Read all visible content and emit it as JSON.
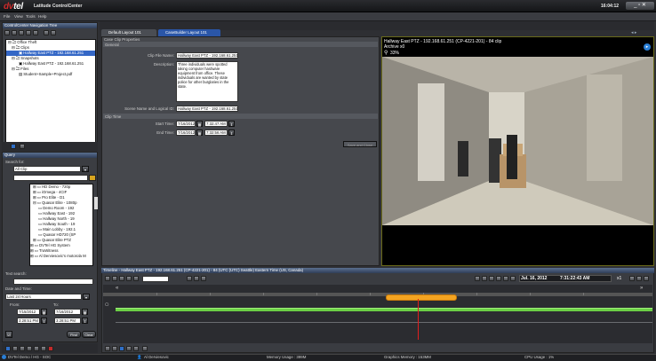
{
  "app": {
    "logo_prefix": "dv",
    "logo_suffix": "tel",
    "title": "Latitude ControlCenter",
    "clock": "16:04:12"
  },
  "menu": [
    "File",
    "View",
    "Tools",
    "Help"
  ],
  "nav_tree": {
    "title": "ControlCenter Navigation Tree",
    "items": [
      {
        "label": "Office Theft",
        "depth": 0
      },
      {
        "label": "Clips",
        "depth": 1
      },
      {
        "label": "Hallway East PTZ - 192.168.61.251",
        "depth": 2,
        "selected": true
      },
      {
        "label": "Snapshots",
        "depth": 1
      },
      {
        "label": "Hallway East PTZ - 192.168.61.251",
        "depth": 2
      },
      {
        "label": "Files",
        "depth": 1
      },
      {
        "label": "Student+Sample+Project.pdf",
        "depth": 2
      }
    ]
  },
  "query": {
    "title": "Query",
    "search_for_label": "Search for:",
    "search_for_value": "All Clip",
    "tree_items": [
      {
        "label": "HD Demo - 720p",
        "depth": 1
      },
      {
        "label": "iOmega - 4CIF",
        "depth": 1
      },
      {
        "label": "Pro Elite - D1",
        "depth": 1
      },
      {
        "label": "Quasar Elite - 1080p",
        "depth": 1
      },
      {
        "label": "Demo Room - 192",
        "depth": 2
      },
      {
        "label": "Hallway East - 192",
        "depth": 2
      },
      {
        "label": "Hallway North - 19",
        "depth": 2
      },
      {
        "label": "Hallway South - 19",
        "depth": 2
      },
      {
        "label": "Main Lobby - 192.1",
        "depth": 2
      },
      {
        "label": "Quasar HD720 (SP",
        "depth": 2
      },
      {
        "label": "Quasar Elite PTZ",
        "depth": 1
      },
      {
        "label": "DVTel HG System",
        "depth": 0
      },
      {
        "label": "TruWitness",
        "depth": 0
      },
      {
        "label": "Al Derviesovic's motorola M",
        "depth": 0
      }
    ],
    "text_search_label": "Text search:",
    "date_time_label": "Date and Time:",
    "date_range_value": "Last 24 Hours",
    "from_label": "From:",
    "to_label": "To:",
    "from_date": "7/15/2012",
    "to_date": "7/16/2012",
    "from_time": "3:28:51 PM",
    "to_time": "3:28:51 PM",
    "find_button": "Find",
    "clear_button": "Clear"
  },
  "tabs": [
    {
      "label": "Default Layout 101",
      "active": false
    },
    {
      "label": "CaseBuilder Layout 101",
      "active": true
    }
  ],
  "clip_props": {
    "title": "Case Clip Properties",
    "general_label": "General",
    "clip_file_name_label": "Clip File Name:",
    "clip_file_name_value": "Hallway East PTZ - 192.168.61.251",
    "description_label": "Description:",
    "description_value": "Three individuals were spotted taking computer hardware equipment from office. These individuals are wanted by state police for other burglaries in the state.",
    "scene_label": "Scene Name and Logical ID:",
    "scene_value": "Hallway East PTZ - 192.168.61.251",
    "clip_time_label": "Clip Time",
    "start_label": "Start Time:",
    "end_label": "End Time:",
    "start_date": "7/16/2012",
    "start_time": "7:32:47 AM",
    "end_date": "7/16/2012",
    "end_time": "7:32:56 AM",
    "save_button": "Save and Close"
  },
  "video": {
    "title": "Hallway East PTZ - 192.168.61.251 (CP-4221-201) - 84 clip",
    "subtitle": "Archive x0",
    "zoom": "33%"
  },
  "timeline": {
    "title": "Timeline - Hallway East PTZ - 192.168.61.251 (CP-4221-201) - 84 (UTC (UTC) Seattle) Eastern Time (US, Canada)",
    "date_readout": "Jul. 16, 2012",
    "time_readout": "7:31:22:43 AM",
    "speed": "x1"
  },
  "status": {
    "item1": "DVTel Demo / HG - SOC",
    "user": "Al Derviesovic",
    "memory": "Memory Usage : 399M",
    "graphics": "Graphics Memory : 153MM",
    "cpu": "CPU Usage : 1%"
  }
}
